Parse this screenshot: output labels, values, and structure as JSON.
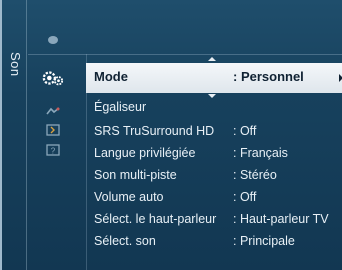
{
  "sidebar": {
    "title": "Son"
  },
  "icons": [
    "picture-icon",
    "sound-gear-icon",
    "setup-icon",
    "input-icon",
    "help-icon"
  ],
  "menu": {
    "selected": {
      "label": "Mode",
      "value": ": Personnel"
    },
    "items": [
      {
        "label": "Égaliseur",
        "value": ""
      },
      {
        "label": "SRS TruSurround HD",
        "value": ": Off"
      },
      {
        "label": "Langue privilégiée",
        "value": ": Français"
      },
      {
        "label": "Son multi-piste",
        "value": ": Stéréo"
      },
      {
        "label": "Volume auto",
        "value": ": Off"
      },
      {
        "label": "Sélect. le haut-parleur",
        "value": ": Haut-parleur TV"
      },
      {
        "label": "Sélect. son",
        "value": ": Principale"
      }
    ]
  }
}
